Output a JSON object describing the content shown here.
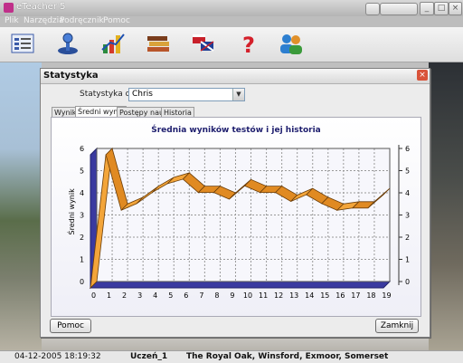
{
  "window": {
    "title": "eTeacher 5"
  },
  "menu": [
    "Plik",
    "Narzędzia",
    "Podręcznik",
    "Pomoc"
  ],
  "toolbar_icons": [
    "notes-icon",
    "joystick-icon",
    "chart-icon",
    "books-icon",
    "flags-icon",
    "help-icon",
    "users-icon"
  ],
  "dialog": {
    "title": "Statystyka",
    "stat_for_label": "Statystyka dla:",
    "selected_user": "Chris",
    "tabs": [
      "Wyniki",
      "Średni wynik",
      "Postępy nauki",
      "Historia"
    ],
    "active_tab": 1,
    "help_button": "Pomoc",
    "close_button": "Zamknij"
  },
  "chart_data": {
    "type": "line",
    "title": "Średnia wyników testów i jej historia",
    "ylabel": "Średni wynik",
    "xlabel": "",
    "x": [
      0,
      1,
      2,
      3,
      4,
      5,
      6,
      7,
      8,
      9,
      10,
      11,
      12,
      13,
      14,
      15,
      16,
      17,
      18,
      19
    ],
    "series": [
      {
        "values": [
          0,
          6,
          3.5,
          3.8,
          4.3,
          4.7,
          4.9,
          4.3,
          4.3,
          4.0,
          4.6,
          4.3,
          4.3,
          3.9,
          4.2,
          3.8,
          3.5,
          3.6,
          3.6,
          4.2
        ]
      }
    ],
    "ylim": [
      0,
      6
    ],
    "yticks": [
      0,
      1,
      2,
      3,
      4,
      5,
      6
    ],
    "grid": true,
    "series_color": "#f0a030",
    "side_wall_color": "#3a3aa0"
  },
  "status": {
    "datetime": "04-12-2005 18:19:32",
    "lesson": "Uczeń_1",
    "location": "The Royal Oak, Winsford, Exmoor, Somerset"
  }
}
